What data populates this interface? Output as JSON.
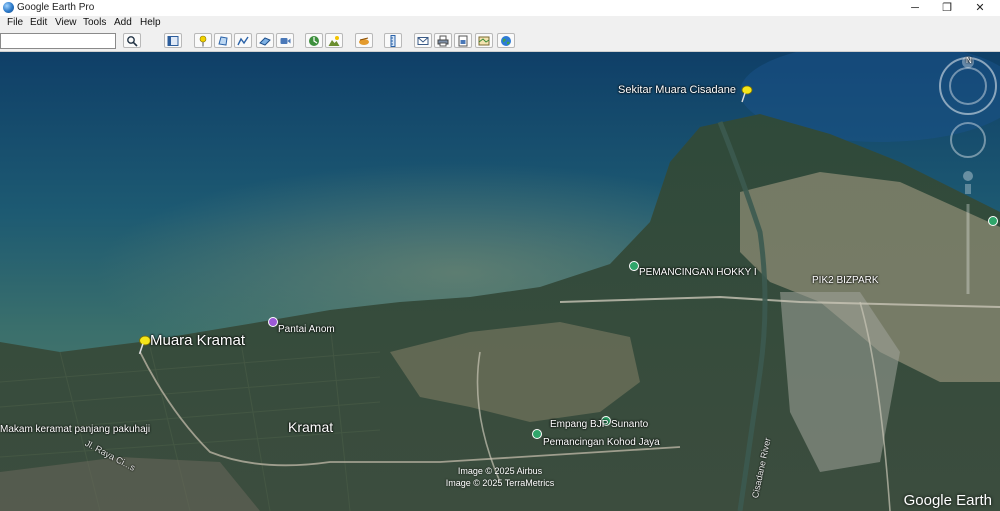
{
  "window": {
    "title": "Google Earth Pro",
    "minimize": "─",
    "maximize": "❐",
    "close": "✕"
  },
  "menu": {
    "items": [
      "File",
      "Edit",
      "View",
      "Tools",
      "Add",
      "Help"
    ]
  },
  "search": {
    "value": ""
  },
  "map": {
    "places": {
      "sekitar": "Sekitar Muara Cisadane",
      "muara_kramat": "Muara Kramat",
      "pantai_anom": "Pantai Anom",
      "pemancingan_hokky": "PEMANCINGAN HOKKY I",
      "pik2": "PIK2 BIZPARK",
      "makam": "Makam keramat panjang pakuhaji",
      "kramat": "Kramat",
      "empang": "Empang BJP Sunanto",
      "kohod": "Pemancingan Kohod Jaya",
      "jl_raya": "Jl. Raya Ci...s",
      "cisadane_river": "Cisadane River"
    },
    "attribution": [
      "Image © 2025 Airbus",
      "Image © 2025 TerraMetrics"
    ],
    "logo": "Google Earth",
    "compass_north": "N"
  },
  "colors": {
    "pin": "#f5e61a",
    "poi_green": "#2fa56a",
    "poi_purple": "#9b59d6"
  }
}
